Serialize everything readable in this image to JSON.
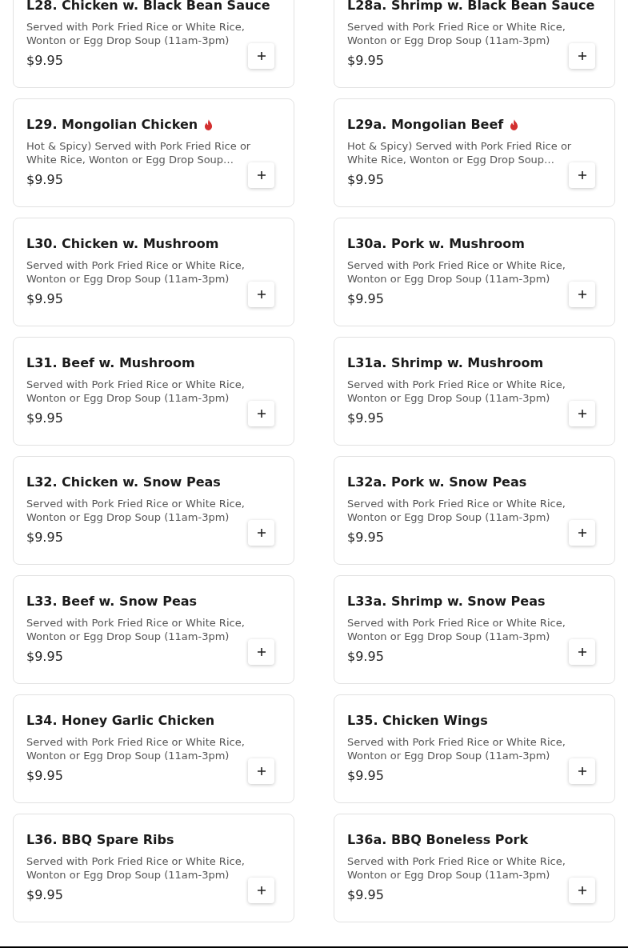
{
  "menu_items": [
    {
      "name": "L28. Chicken w. Black Bean Sauce",
      "spicy": false,
      "description": "Served with Pork Fried Rice or White Rice, Wonton or Egg Drop Soup (11am-3pm)",
      "price": "$9.95"
    },
    {
      "name": "L28a. Shrimp w. Black Bean Sauce",
      "spicy": false,
      "description": "Served with Pork Fried Rice or White Rice, Wonton or Egg Drop Soup (11am-3pm)",
      "price": "$9.95"
    },
    {
      "name": "L29. Mongolian Chicken",
      "spicy": true,
      "description": "Hot & Spicy) Served with Pork Fried Rice or White Rice, Wonton or Egg Drop Soup…",
      "price": "$9.95"
    },
    {
      "name": "L29a. Mongolian Beef",
      "spicy": true,
      "description": "Hot & Spicy) Served with Pork Fried Rice or White Rice, Wonton or Egg Drop Soup…",
      "price": "$9.95"
    },
    {
      "name": "L30. Chicken w. Mushroom",
      "spicy": false,
      "description": "Served with Pork Fried Rice or White Rice, Wonton or Egg Drop Soup (11am-3pm)",
      "price": "$9.95"
    },
    {
      "name": "L30a. Pork w. Mushroom",
      "spicy": false,
      "description": "Served with Pork Fried Rice or White Rice, Wonton or Egg Drop Soup (11am-3pm)",
      "price": "$9.95"
    },
    {
      "name": "L31. Beef w. Mushroom",
      "spicy": false,
      "description": "Served with Pork Fried Rice or White Rice, Wonton or Egg Drop Soup (11am-3pm)",
      "price": "$9.95"
    },
    {
      "name": "L31a. Shrimp w. Mushroom",
      "spicy": false,
      "description": "Served with Pork Fried Rice or White Rice, Wonton or Egg Drop Soup (11am-3pm)",
      "price": "$9.95"
    },
    {
      "name": "L32. Chicken w. Snow Peas",
      "spicy": false,
      "description": "Served with Pork Fried Rice or White Rice, Wonton or Egg Drop Soup (11am-3pm)",
      "price": "$9.95"
    },
    {
      "name": "L32a. Pork w. Snow Peas",
      "spicy": false,
      "description": "Served with Pork Fried Rice or White Rice, Wonton or Egg Drop Soup (11am-3pm)",
      "price": "$9.95"
    },
    {
      "name": "L33. Beef w. Snow Peas",
      "spicy": false,
      "description": "Served with Pork Fried Rice or White Rice, Wonton or Egg Drop Soup (11am-3pm)",
      "price": "$9.95"
    },
    {
      "name": "L33a. Shrimp w. Snow Peas",
      "spicy": false,
      "description": "Served with Pork Fried Rice or White Rice, Wonton or Egg Drop Soup (11am-3pm)",
      "price": "$9.95"
    },
    {
      "name": "L34. Honey Garlic Chicken",
      "spicy": false,
      "description": "Served with Pork Fried Rice or White Rice, Wonton or Egg Drop Soup (11am-3pm)",
      "price": "$9.95"
    },
    {
      "name": "L35. Chicken Wings",
      "spicy": false,
      "description": "Served with Pork Fried Rice or White Rice, Wonton or Egg Drop Soup (11am-3pm)",
      "price": "$9.95"
    },
    {
      "name": "L36. BBQ Spare Ribs",
      "spicy": false,
      "description": "Served with Pork Fried Rice or White Rice, Wonton or Egg Drop Soup (11am-3pm)",
      "price": "$9.95"
    },
    {
      "name": "L36a. BBQ Boneless Pork",
      "spicy": false,
      "description": "Served with Pork Fried Rice or White Rice, Wonton or Egg Drop Soup (11am-3pm)",
      "price": "$9.95"
    }
  ]
}
